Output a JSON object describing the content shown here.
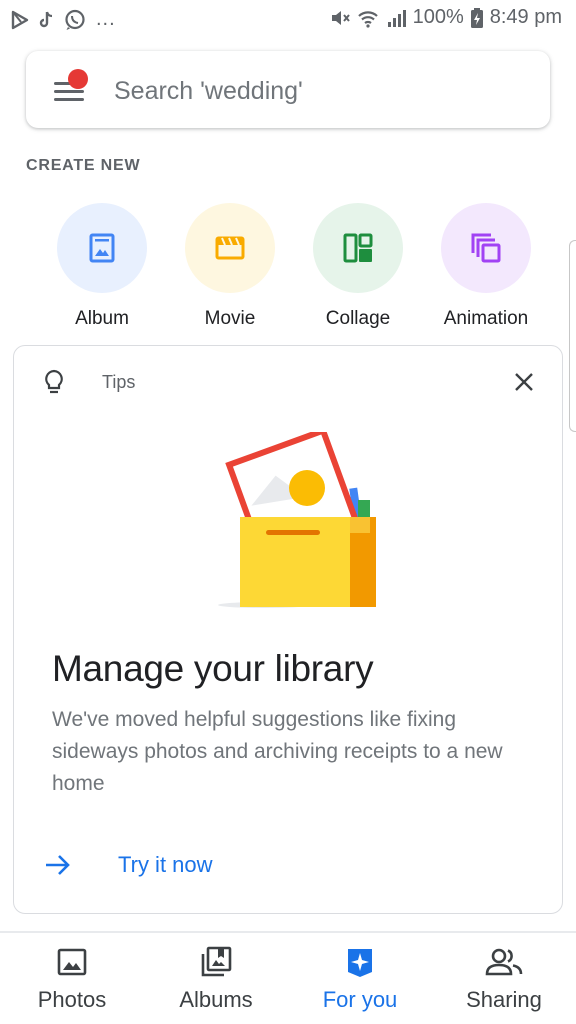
{
  "status_bar": {
    "battery": "100%",
    "time": "8:49 pm",
    "overflow": "..."
  },
  "search": {
    "placeholder": "Search 'wedding'"
  },
  "create_new": {
    "label": "CREATE NEW",
    "items": [
      {
        "label": "Album",
        "icon": "album-icon",
        "bg": "#e8f0fe",
        "color": "#4285f4"
      },
      {
        "label": "Movie",
        "icon": "movie-icon",
        "bg": "#fef7e0",
        "color": "#f9ab00"
      },
      {
        "label": "Collage",
        "icon": "collage-icon",
        "bg": "#e6f4ea",
        "color": "#1e8e3e"
      },
      {
        "label": "Animation",
        "icon": "animation-icon",
        "bg": "#f3e8fd",
        "color": "#a142f4"
      }
    ]
  },
  "tips_card": {
    "header": "Tips",
    "title": "Manage your library",
    "body": "We've moved helpful suggestions like fixing sideways photos and archiving receipts to a new home",
    "action": "Try it now"
  },
  "bottom_nav": {
    "items": [
      {
        "label": "Photos",
        "icon": "photos-icon",
        "active": false
      },
      {
        "label": "Albums",
        "icon": "albums-icon",
        "active": false
      },
      {
        "label": "For you",
        "icon": "for-you-icon",
        "active": true
      },
      {
        "label": "Sharing",
        "icon": "sharing-icon",
        "active": false
      }
    ]
  },
  "colors": {
    "accent": "#1a73e8",
    "notification_dot": "#e53935"
  }
}
